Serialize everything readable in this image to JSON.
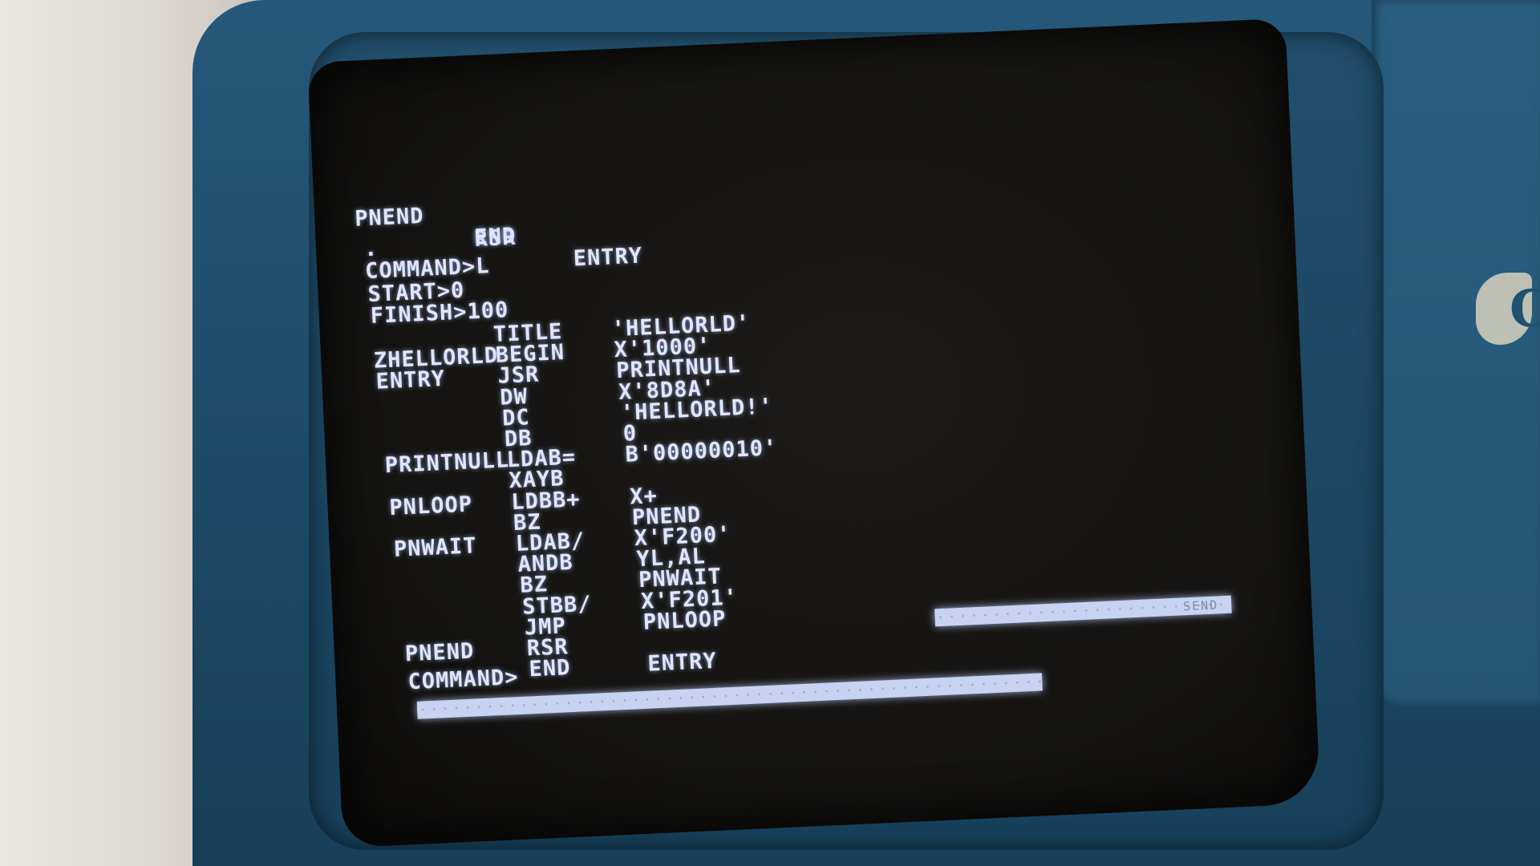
{
  "terminal": {
    "header": [
      {
        "label": "PNEND",
        "op": "RSR",
        "arg": ""
      },
      {
        "label": "",
        "op": "END",
        "arg": "ENTRY"
      }
    ],
    "prompt_dot": ".",
    "session": [
      "COMMAND>L",
      "START>0",
      "FINISH>100"
    ],
    "listing": [
      {
        "label": "",
        "op": "TITLE",
        "arg": "'HELLORLD'"
      },
      {
        "label": "ZHELLORLD",
        "op": "BEGIN",
        "arg": "X'1000'"
      },
      {
        "label": "ENTRY",
        "op": "JSR",
        "arg": "PRINTNULL"
      },
      {
        "label": "",
        "op": "DW",
        "arg": "X'8D8A'"
      },
      {
        "label": "",
        "op": "DC",
        "arg": "'HELLORLD!'"
      },
      {
        "label": "",
        "op": "DB",
        "arg": "0"
      },
      {
        "label": "PRINTNULL",
        "op": "LDAB=",
        "arg": "B'00000010'"
      },
      {
        "label": "",
        "op": "XAYB",
        "arg": ""
      },
      {
        "label": "PNLOOP",
        "op": "LDBB+",
        "arg": "X+"
      },
      {
        "label": "",
        "op": "BZ",
        "arg": "PNEND"
      },
      {
        "label": "PNWAIT",
        "op": "LDAB/",
        "arg": "X'F200'"
      },
      {
        "label": "",
        "op": "ANDB",
        "arg": "YL,AL"
      },
      {
        "label": "",
        "op": "BZ",
        "arg": "PNWAIT"
      },
      {
        "label": "",
        "op": "STBB/",
        "arg": "X'F201'"
      },
      {
        "label": "",
        "op": "JMP",
        "arg": "PNLOOP"
      },
      {
        "label": "PNEND",
        "op": "RSR",
        "arg": ""
      },
      {
        "label": "",
        "op": "END",
        "arg": "ENTRY"
      }
    ],
    "command_prompt": "COMMAND>",
    "send_label": "SEND"
  },
  "logo": {
    "letter": "C"
  },
  "colors": {
    "phosphor": "#dfe6ff",
    "housing": "#1e4d6a",
    "screen": "#151412"
  }
}
